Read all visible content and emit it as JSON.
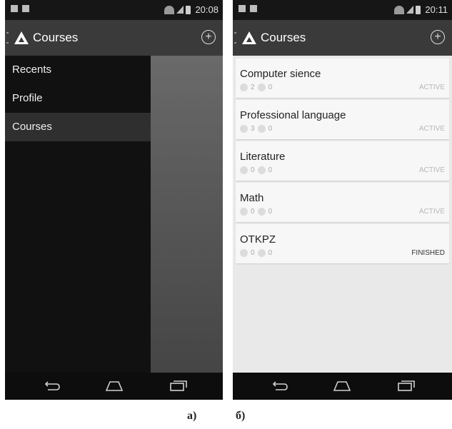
{
  "left_screen": {
    "status_time": "20:08",
    "title": "Courses",
    "drawer_items": [
      "Recents",
      "Profile",
      "Courses"
    ],
    "selected_item": "Courses"
  },
  "right_screen": {
    "status_time": "20:11",
    "title": "Courses",
    "courses": [
      {
        "name": "Computer sience",
        "count1": "2",
        "count2": "0",
        "status": "ACTIVE"
      },
      {
        "name": "Professional language",
        "count1": "3",
        "count2": "0",
        "status": "ACTIVE"
      },
      {
        "name": "Literature",
        "count1": "0",
        "count2": "0",
        "status": "ACTIVE"
      },
      {
        "name": "Math",
        "count1": "0",
        "count2": "0",
        "status": "ACTIVE"
      },
      {
        "name": "OTKPZ",
        "count1": "0",
        "count2": "0",
        "status": "FINISHED"
      }
    ]
  },
  "captions": {
    "left": "а)",
    "right": "б)"
  },
  "icons": {
    "left": [
      "notification-icon",
      "wifi-icon",
      "signal-icon",
      "battery-icon",
      "drawer-indicator-icon",
      "app-logo-icon",
      "add-circle-icon",
      "back-icon",
      "home-icon",
      "recents-icon"
    ],
    "right": [
      "notification-icon",
      "wifi-icon",
      "signal-icon",
      "battery-icon",
      "drawer-indicator-icon",
      "app-logo-icon",
      "add-circle-icon",
      "back-icon",
      "home-icon",
      "recents-icon"
    ]
  },
  "colors": {
    "action_bar": "#3a3a3a",
    "drawer": "#111111",
    "list_bg": "#e9e9e9",
    "card_bg": "#f7f7f7"
  }
}
